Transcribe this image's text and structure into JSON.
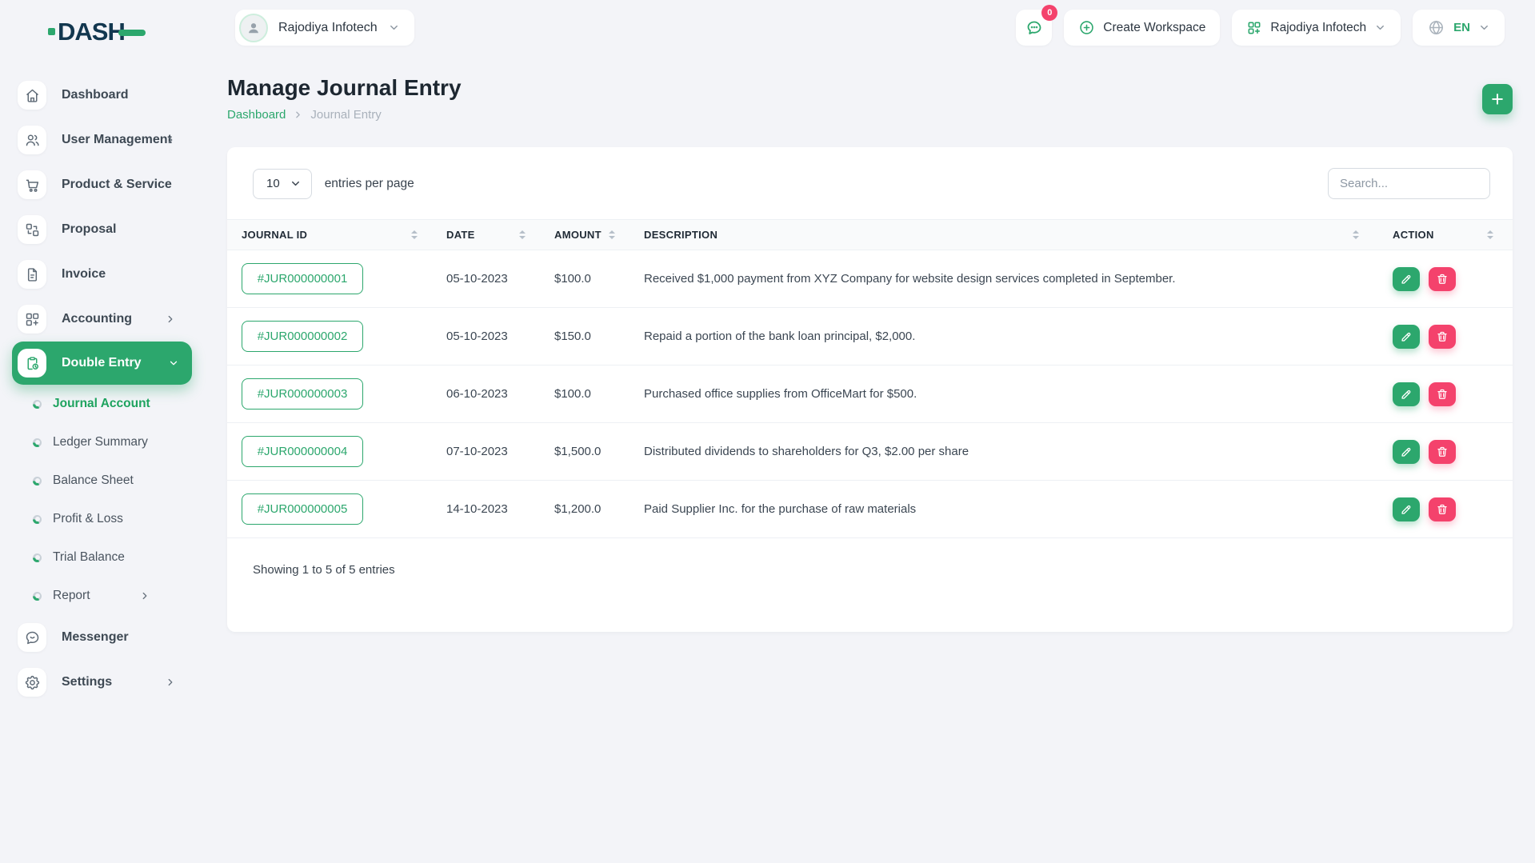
{
  "colors": {
    "accent": "#2ca76d",
    "danger": "#f4426c",
    "navy": "#12374f",
    "bg": "#f3f4f8"
  },
  "app": {
    "logo_text": "DASH"
  },
  "topbar": {
    "workspace_selector": {
      "label": "Rajodiya Infotech"
    },
    "notification_badge": "0",
    "create_workspace_label": "Create Workspace",
    "company_selector": {
      "label": "Rajodiya Infotech"
    },
    "language_selector": {
      "label": "EN"
    }
  },
  "sidebar": {
    "items": [
      {
        "label": "Dashboard"
      },
      {
        "label": "User Management"
      },
      {
        "label": "Product & Service"
      },
      {
        "label": "Proposal"
      },
      {
        "label": "Invoice"
      },
      {
        "label": "Accounting"
      },
      {
        "label": "Double Entry"
      },
      {
        "label": "Messenger"
      },
      {
        "label": "Settings"
      }
    ],
    "double_entry_children": [
      {
        "label": "Journal Account"
      },
      {
        "label": "Ledger Summary"
      },
      {
        "label": "Balance Sheet"
      },
      {
        "label": "Profit & Loss"
      },
      {
        "label": "Trial Balance"
      },
      {
        "label": "Report"
      }
    ]
  },
  "page": {
    "title": "Manage Journal Entry",
    "breadcrumb": {
      "home": "Dashboard",
      "current": "Journal Entry"
    },
    "add_button": "+"
  },
  "table_card": {
    "entries_per_page": {
      "selected": "10",
      "label": "entries per page"
    },
    "search": {
      "placeholder": "Search..."
    },
    "columns": [
      "JOURNAL ID",
      "DATE",
      "AMOUNT",
      "DESCRIPTION",
      "ACTION"
    ],
    "rows": [
      {
        "journal_id": "#JUR000000001",
        "date": "05-10-2023",
        "amount": "$100.0",
        "description": "Received $1,000 payment from XYZ Company for website design services completed in September."
      },
      {
        "journal_id": "#JUR000000002",
        "date": "05-10-2023",
        "amount": "$150.0",
        "description": "Repaid a portion of the bank loan principal, $2,000."
      },
      {
        "journal_id": "#JUR000000003",
        "date": "06-10-2023",
        "amount": "$100.0",
        "description": "Purchased office supplies from OfficeMart for $500."
      },
      {
        "journal_id": "#JUR000000004",
        "date": "07-10-2023",
        "amount": "$1,500.0",
        "description": "Distributed dividends to shareholders for Q3, $2.00 per share"
      },
      {
        "journal_id": "#JUR000000005",
        "date": "14-10-2023",
        "amount": "$1,200.0",
        "description": "Paid Supplier Inc. for the purchase of raw materials"
      }
    ],
    "footer": "Showing 1 to 5 of 5 entries"
  }
}
